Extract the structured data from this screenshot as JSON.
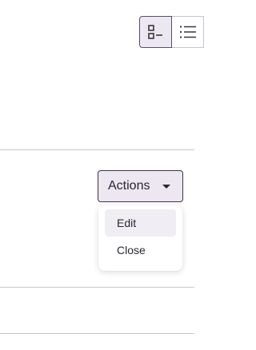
{
  "view_toggle": {
    "options": [
      {
        "icon": "grid-list-icon",
        "active": true
      },
      {
        "icon": "list-icon",
        "active": false
      }
    ]
  },
  "actions": {
    "label": "Actions",
    "caret_icon": "caret-down-icon",
    "menu": {
      "items": [
        {
          "label": "Edit",
          "highlighted": true
        },
        {
          "label": "Close",
          "highlighted": false
        }
      ]
    }
  },
  "colors": {
    "accent_border": "#5c4a6b",
    "button_bg": "#ece7f1",
    "divider": "#c9c6cc",
    "text": "#2b2535"
  }
}
